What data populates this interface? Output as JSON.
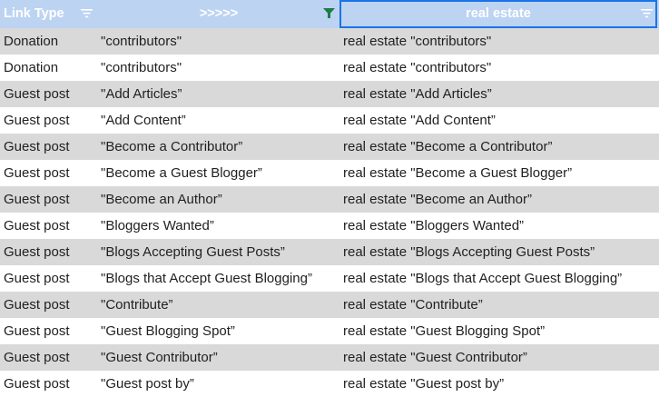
{
  "header": {
    "col1": "Link Type",
    "col2": ">>>>>",
    "col3": "real estate"
  },
  "colors": {
    "header_bg": "#bcd3f2",
    "alt_row_bg": "#d9d9d9",
    "active_filter": "#1e7b4a",
    "selection_border": "#1a73e8"
  },
  "rows": [
    {
      "type": "Donation",
      "keyword": "\"contributors\"",
      "query": "real estate \"contributors\""
    },
    {
      "type": "Donation",
      "keyword": "\"contributors\"",
      "query": "real estate \"contributors\""
    },
    {
      "type": "Guest post",
      "keyword": "\"Add Articles”",
      "query": "real estate \"Add Articles”"
    },
    {
      "type": "Guest post",
      "keyword": "\"Add Content”",
      "query": "real estate \"Add Content”"
    },
    {
      "type": "Guest post",
      "keyword": "\"Become a Contributor”",
      "query": "real estate \"Become a Contributor”"
    },
    {
      "type": "Guest post",
      "keyword": "\"Become a Guest Blogger”",
      "query": "real estate \"Become a Guest Blogger”"
    },
    {
      "type": "Guest post",
      "keyword": "\"Become an Author”",
      "query": "real estate \"Become an Author”"
    },
    {
      "type": "Guest post",
      "keyword": "\"Bloggers Wanted”",
      "query": "real estate \"Bloggers Wanted”"
    },
    {
      "type": "Guest post",
      "keyword": "\"Blogs Accepting Guest Posts”",
      "query": "real estate \"Blogs Accepting Guest Posts”"
    },
    {
      "type": "Guest post",
      "keyword": "\"Blogs that Accept Guest Blogging”",
      "query": "real estate \"Blogs that Accept Guest Blogging”"
    },
    {
      "type": "Guest post",
      "keyword": "\"Contribute”",
      "query": "real estate \"Contribute”"
    },
    {
      "type": "Guest post",
      "keyword": "\"Guest Blogging Spot”",
      "query": "real estate \"Guest Blogging Spot”"
    },
    {
      "type": "Guest post",
      "keyword": "\"Guest Contributor”",
      "query": "real estate \"Guest Contributor”"
    },
    {
      "type": "Guest post",
      "keyword": "\"Guest post by”",
      "query": "real estate \"Guest post by”"
    }
  ]
}
